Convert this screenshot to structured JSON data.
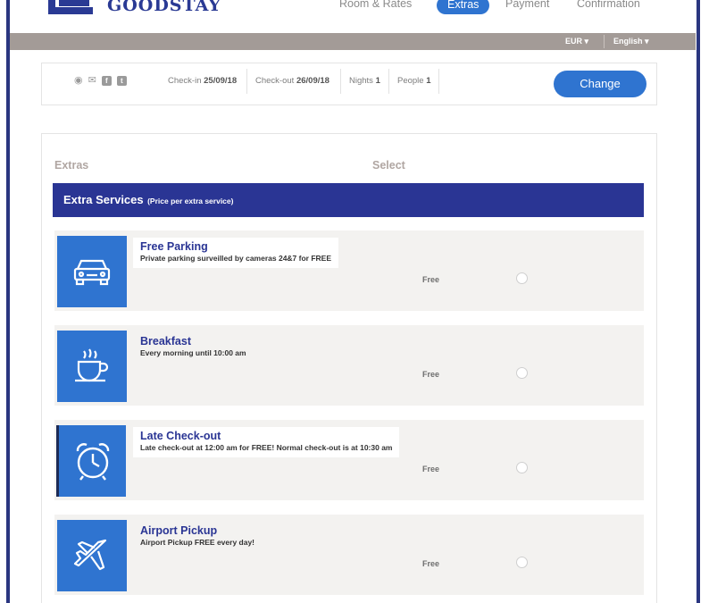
{
  "brand": {
    "name": "GOODSTAY"
  },
  "nav": {
    "items": [
      {
        "label": "Room & Rates"
      },
      {
        "label": "Extras"
      },
      {
        "label": "Payment"
      },
      {
        "label": "Confirmation"
      }
    ],
    "active": "Extras"
  },
  "topbar": {
    "currency": "EUR ▾",
    "language": "English ▾"
  },
  "summary": {
    "icons": [
      "map-marker-icon",
      "envelope-icon",
      "facebook-icon",
      "twitter-icon"
    ],
    "checkin_label": "Check-in",
    "checkin_value": "25/09/18",
    "checkout_label": "Check-out",
    "checkout_value": "26/09/18",
    "nights_label": "Nights",
    "nights_value": "1",
    "people_label": "People",
    "people_value": "1",
    "change_label": "Change"
  },
  "extras": {
    "col_extras": "Extras",
    "col_select": "Select",
    "banner_title": "Extra Services",
    "banner_sub": "(Price per extra service)",
    "services": [
      {
        "title": "Free Parking",
        "desc": "Private parking surveilled by cameras 24&7 for FREE",
        "price": "Free",
        "icon": "car-icon"
      },
      {
        "title": "Breakfast",
        "desc": "Every morning until 10:00 am",
        "price": "Free",
        "icon": "coffee-cup-icon"
      },
      {
        "title": "Late Check-out",
        "desc": "Late check-out at 12:00 am for FREE! Normal check-out is at 10:30 am",
        "price": "Free",
        "icon": "alarm-clock-icon"
      },
      {
        "title": "Airport Pickup",
        "desc": "Airport Pickup FREE every day!",
        "price": "Free",
        "icon": "airplane-icon"
      }
    ]
  },
  "colors": {
    "navy": "#2a3594",
    "blue": "#2f74d0",
    "bar": "#a39b97"
  }
}
